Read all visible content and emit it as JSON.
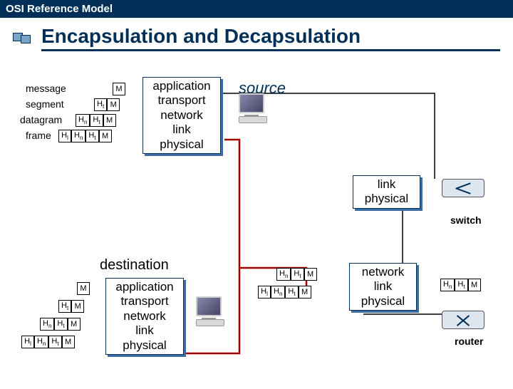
{
  "header": "OSI Reference Model",
  "title": "Encapsulation and Decapsulation",
  "source_label": "source",
  "destination_label": "destination",
  "switch_label": "switch",
  "router_label": "router",
  "row_labels": {
    "message": "message",
    "segment": "segment",
    "datagram": "datagram",
    "frame": "frame"
  },
  "headers": {
    "M": "M",
    "Ht": "Ht",
    "Hn": "Hn",
    "Hl": "Hl"
  },
  "stacks": {
    "full": [
      "application",
      "transport",
      "network",
      "link",
      "physical"
    ],
    "switch": [
      "link",
      "physical"
    ],
    "router": [
      "network",
      "link",
      "physical"
    ]
  }
}
